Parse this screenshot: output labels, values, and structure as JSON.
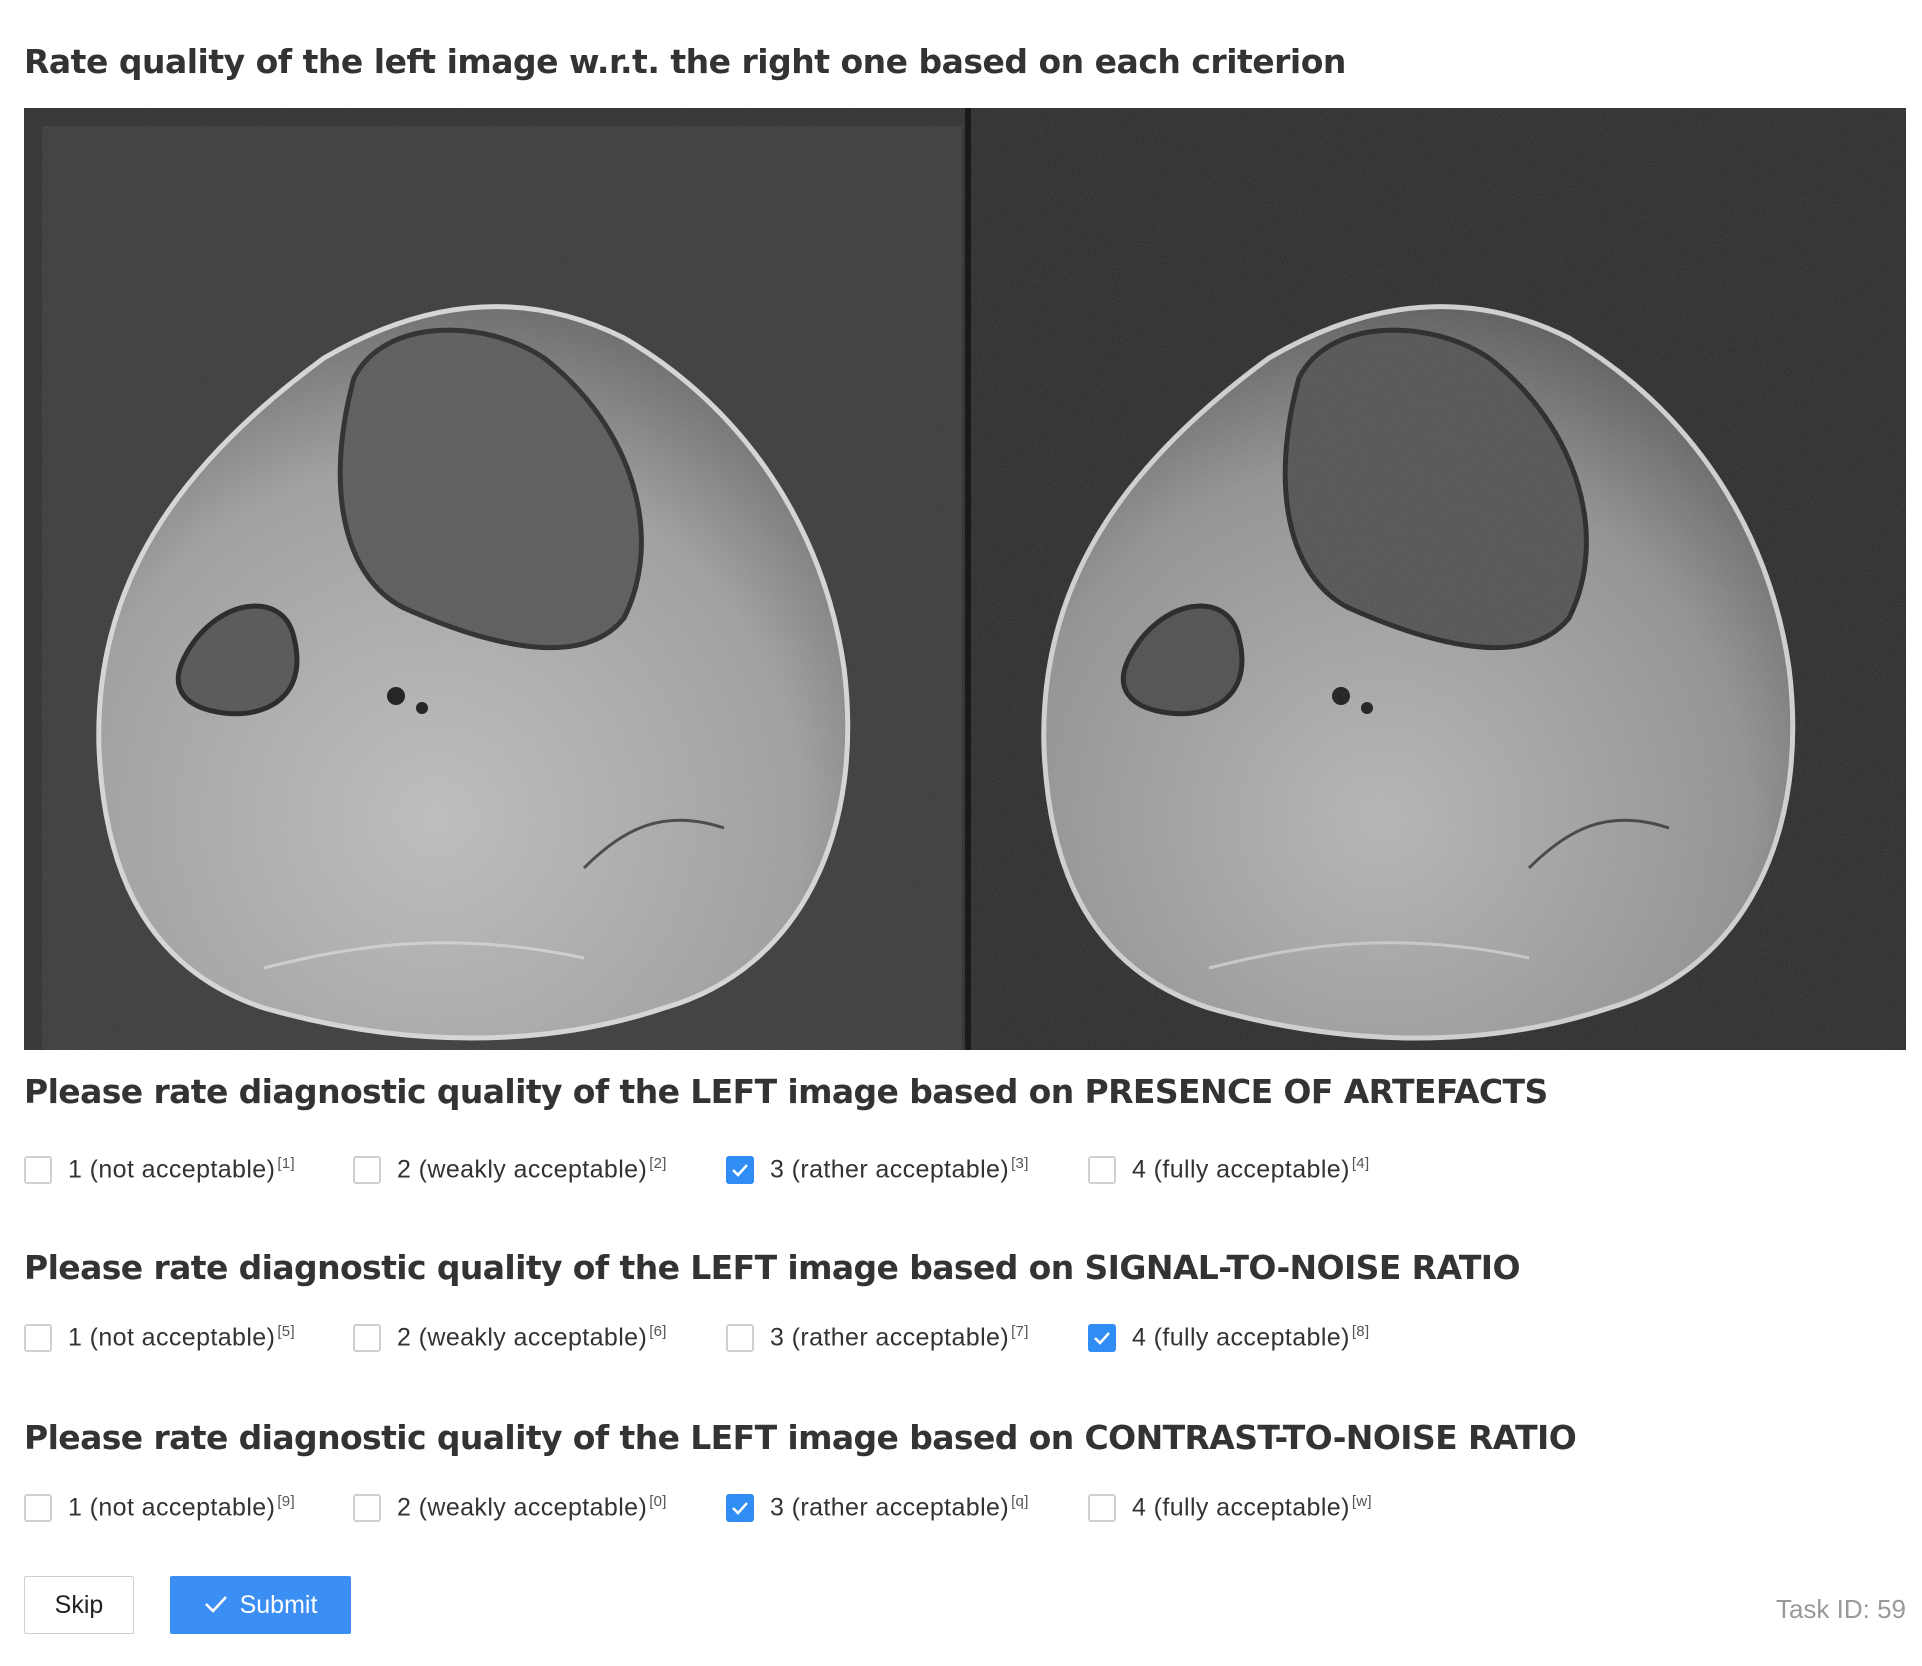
{
  "title": "Rate quality of the left image w.r.t. the right one based on each criterion",
  "questions": [
    {
      "heading": "Please rate diagnostic quality of the LEFT image based on PRESENCE OF ARTEFACTS",
      "options": [
        {
          "label": "1 (not acceptable)",
          "hotkey": "[1]",
          "checked": false
        },
        {
          "label": "2 (weakly acceptable)",
          "hotkey": "[2]",
          "checked": false
        },
        {
          "label": "3 (rather acceptable)",
          "hotkey": "[3]",
          "checked": true
        },
        {
          "label": "4 (fully acceptable)",
          "hotkey": "[4]",
          "checked": false
        }
      ]
    },
    {
      "heading": "Please rate diagnostic quality of the LEFT image based on SIGNAL-TO-NOISE RATIO",
      "options": [
        {
          "label": "1 (not acceptable)",
          "hotkey": "[5]",
          "checked": false
        },
        {
          "label": "2 (weakly acceptable)",
          "hotkey": "[6]",
          "checked": false
        },
        {
          "label": "3 (rather acceptable)",
          "hotkey": "[7]",
          "checked": false
        },
        {
          "label": "4 (fully acceptable)",
          "hotkey": "[8]",
          "checked": true
        }
      ]
    },
    {
      "heading": "Please rate diagnostic quality of the LEFT image based on CONTRAST-TO-NOISE RATIO",
      "options": [
        {
          "label": "1 (not acceptable)",
          "hotkey": "[9]",
          "checked": false
        },
        {
          "label": "2 (weakly acceptable)",
          "hotkey": "[0]",
          "checked": false
        },
        {
          "label": "3 (rather acceptable)",
          "hotkey": "[q]",
          "checked": true
        },
        {
          "label": "4 (fully acceptable)",
          "hotkey": "[w]",
          "checked": false
        }
      ]
    }
  ],
  "buttons": {
    "skip": "Skip",
    "submit": "Submit",
    "submit_icon": "check-icon"
  },
  "task_id": "Task ID: 59",
  "colors": {
    "accent": "#3b8ef3",
    "checked_box": "#2f8df4",
    "heading": "#333333",
    "muted": "#9a9a9a",
    "viewer_bg": "#1e1e1e"
  }
}
